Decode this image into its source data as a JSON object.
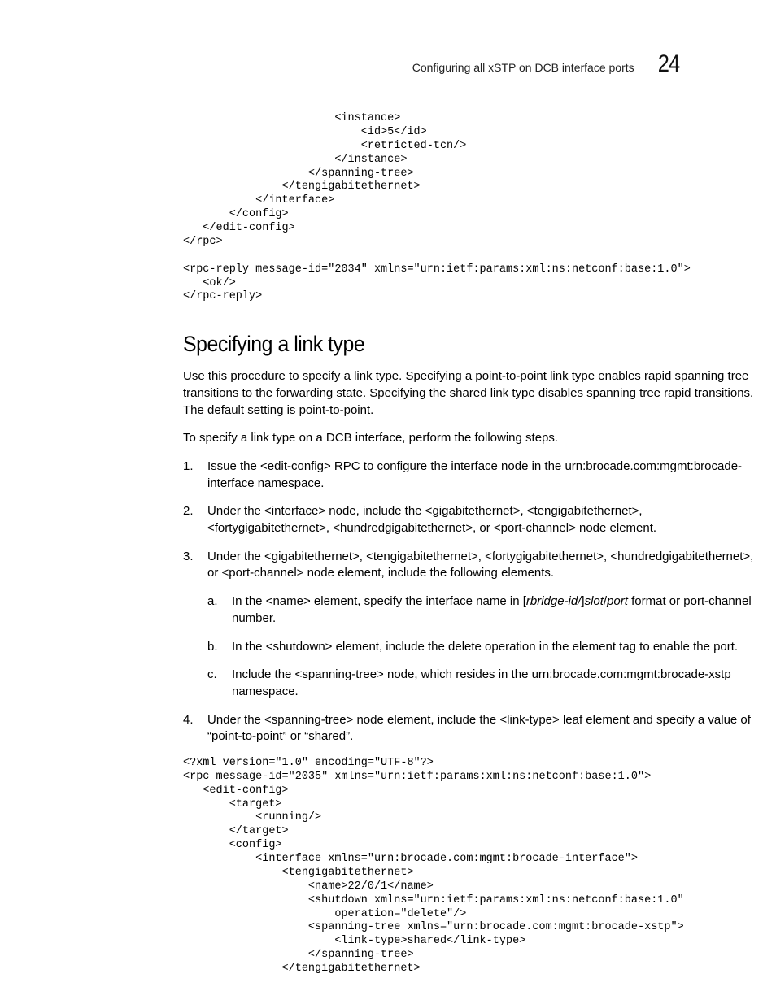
{
  "header": {
    "title": "Configuring all xSTP on DCB interface ports",
    "chapter_number": "24"
  },
  "code1": "                       <instance>\n                           <id>5</id>\n                           <retricted-tcn/>\n                       </instance>\n                   </spanning-tree>\n               </tengigabitethernet>\n           </interface>\n       </config>\n   </edit-config>\n</rpc>\n\n<rpc-reply message-id=\"2034\" xmlns=\"urn:ietf:params:xml:ns:netconf:base:1.0\">\n   <ok/>\n</rpc-reply>",
  "section_heading": "Specifying a link type",
  "para1": "Use this procedure to specify a link type. Specifying a point-to-point link type enables rapid spanning tree transitions to the forwarding state. Specifying the shared link type disables spanning tree rapid transitions. The default setting is point-to-point.",
  "para2": "To specify a link type on a DCB interface, perform the following steps.",
  "steps": {
    "s1": "Issue the <edit-config> RPC to configure the interface node in the urn:brocade.com:mgmt:brocade-interface namespace.",
    "s2": "Under the <interface> node, include the <gigabitethernet>, <tengigabitethernet>, <fortygigabitethernet>, <hundredgigabitethernet>, or <port-channel> node element.",
    "s3_lead": "Under the <gigabitethernet>, <tengigabitethernet>, <fortygigabitethernet>, <hundredgigabitethernet>, or <port-channel> node element, include the following elements.",
    "s3a_pre": "In the <name> element, specify the interface name in [",
    "s3a_v1": "rbridge-id/",
    "s3a_mid1": "]",
    "s3a_v2": "slot",
    "s3a_mid2": "/",
    "s3a_v3": "port",
    "s3a_post": " format or port-channel number.",
    "s3b": "In the <shutdown> element, include the delete operation in the element tag to enable the port.",
    "s3c": "Include the <spanning-tree> node, which resides in the urn:brocade.com:mgmt:brocade-xstp namespace.",
    "s4": "Under the <spanning-tree> node element, include the <link-type> leaf element and specify a value of “point-to-point” or “shared”."
  },
  "code2": "<?xml version=\"1.0\" encoding=\"UTF-8\"?>\n<rpc message-id=\"2035\" xmlns=\"urn:ietf:params:xml:ns:netconf:base:1.0\">\n   <edit-config>\n       <target>\n           <running/>\n       </target>\n       <config>\n           <interface xmlns=\"urn:brocade.com:mgmt:brocade-interface\">\n               <tengigabitethernet>\n                   <name>22/0/1</name>\n                   <shutdown xmlns=\"urn:ietf:params:xml:ns:netconf:base:1.0\"\n                       operation=\"delete\"/>\n                   <spanning-tree xmlns=\"urn:brocade.com:mgmt:brocade-xstp\">\n                       <link-type>shared</link-type>\n                   </spanning-tree>\n               </tengigabitethernet>"
}
